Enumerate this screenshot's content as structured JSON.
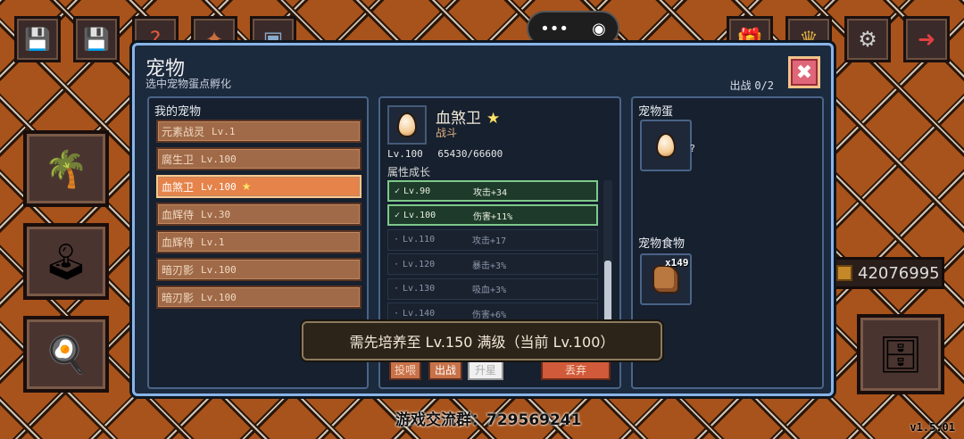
{
  "top_capsule": {
    "menu_icon": "•••",
    "target_icon": "◉"
  },
  "background": {
    "coins": "42076995",
    "qq_group": "游戏交流群：729569241",
    "version": "v1.5.01"
  },
  "modal": {
    "title": "宠物",
    "subtitle": "选中宠物蛋点孵化",
    "deploy_label": "出战",
    "deploy_count": "0/2",
    "close_icon": "✖"
  },
  "my_pets": {
    "title": "我的宠物",
    "items": [
      {
        "name": "元素战灵",
        "level": "Lv.1",
        "selected": false,
        "starred": false
      },
      {
        "name": "腐生卫",
        "level": "Lv.100",
        "selected": false,
        "starred": false
      },
      {
        "name": "血煞卫",
        "level": "Lv.100",
        "selected": true,
        "starred": true
      },
      {
        "name": "血辉侍",
        "level": "Lv.30",
        "selected": false,
        "starred": false
      },
      {
        "name": "血辉侍",
        "level": "Lv.1",
        "selected": false,
        "starred": false
      },
      {
        "name": "暗刃影",
        "level": "Lv.100",
        "selected": false,
        "starred": false
      },
      {
        "name": "暗刃影",
        "level": "Lv.100",
        "selected": false,
        "starred": false
      }
    ],
    "star_icon": "★"
  },
  "pet_detail": {
    "name": "血煞卫",
    "star": "★",
    "type": "战斗",
    "level": "Lv.100",
    "exp": "65430/66600",
    "growth_title": "属性成长",
    "growth": [
      {
        "mark": "✓",
        "level": "Lv.90",
        "bonus": "攻击+34",
        "done": true
      },
      {
        "mark": "✓",
        "level": "Lv.100",
        "bonus": "伤害+11%",
        "done": true
      },
      {
        "mark": "·",
        "level": "Lv.110",
        "bonus": "攻击+17",
        "done": false
      },
      {
        "mark": "·",
        "level": "Lv.120",
        "bonus": "暴击+3%",
        "done": false
      },
      {
        "mark": "·",
        "level": "Lv.130",
        "bonus": "吸血+3%",
        "done": false
      },
      {
        "mark": "·",
        "level": "Lv.140",
        "bonus": "伤害+6%",
        "done": false
      }
    ],
    "buttons": {
      "feed": "投喂",
      "deploy": "出战",
      "upgrade": "升星",
      "discard": "丢弃"
    }
  },
  "right_panel": {
    "egg_title": "宠物蛋",
    "egg_label": "?",
    "food_title": "宠物食物",
    "food_count": "x149"
  },
  "toast": "需先培养至 Lv.150 满级（当前 Lv.100）"
}
